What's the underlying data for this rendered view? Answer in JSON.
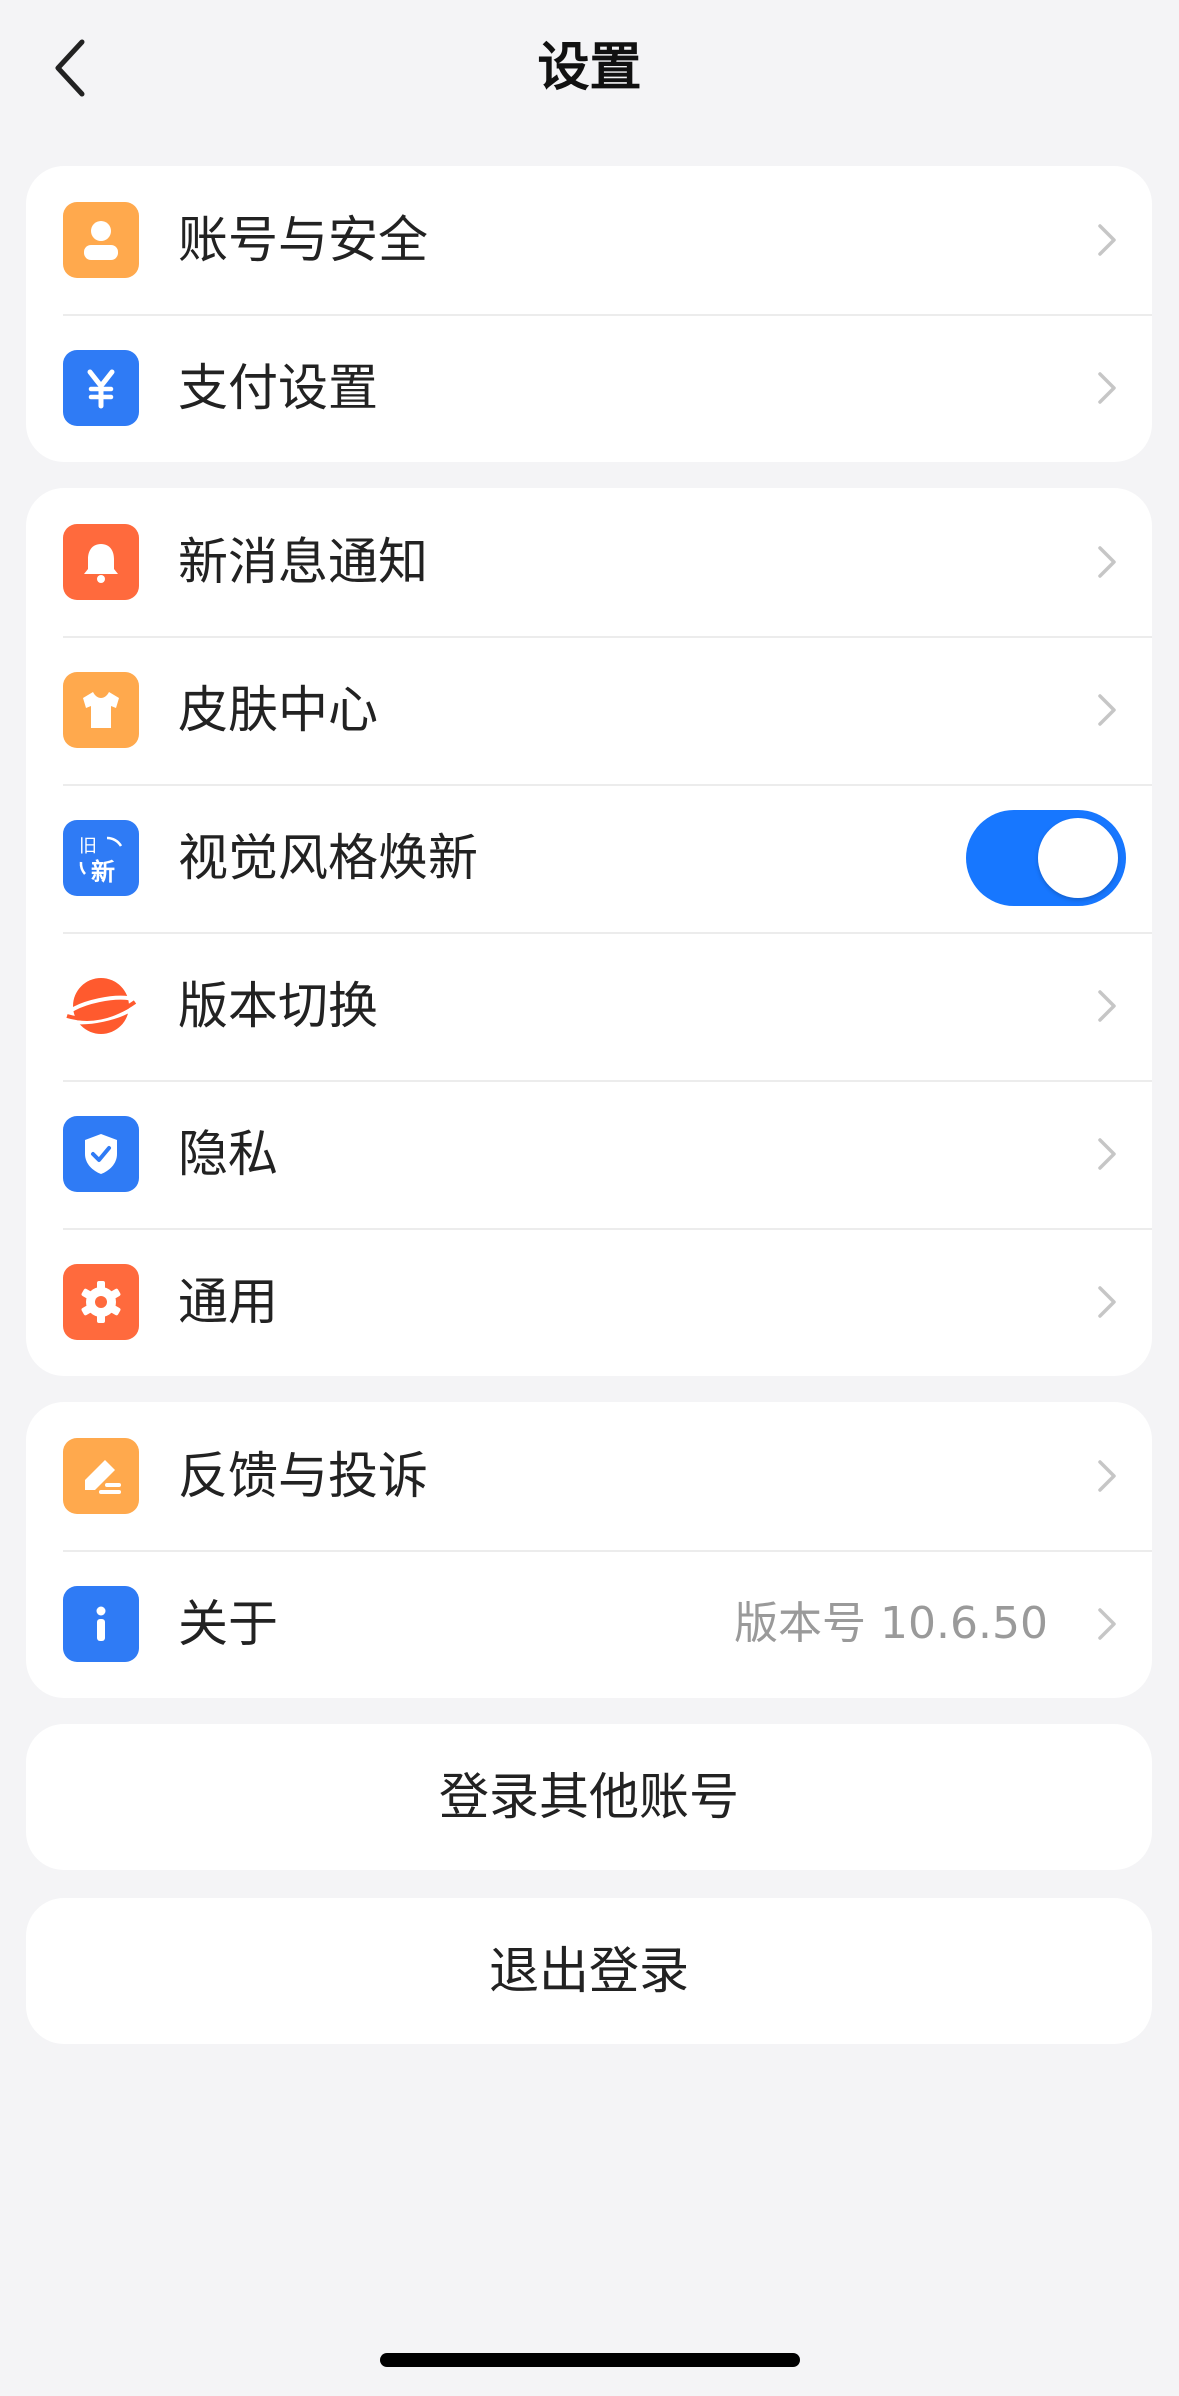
{
  "header": {
    "title": "设置",
    "back_icon": "chevron-left-icon"
  },
  "groups": [
    {
      "items": [
        {
          "label": "账号与安全",
          "icon": "user-icon",
          "color": "#ffa94d",
          "control": "chevron"
        },
        {
          "label": "支付设置",
          "icon": "yen-icon",
          "color": "#2f7bf5",
          "control": "chevron"
        }
      ]
    },
    {
      "items": [
        {
          "label": "新消息通知",
          "icon": "bell-icon",
          "color": "#ff6a3d",
          "control": "chevron"
        },
        {
          "label": "皮肤中心",
          "icon": "tshirt-icon",
          "color": "#ffa94d",
          "control": "chevron"
        },
        {
          "label": "视觉风格焕新",
          "icon": "refresh-new-icon",
          "icon_text_top": "旧",
          "icon_text_bottom": "新",
          "color": "#2f7bf5",
          "control": "toggle",
          "toggle_on": true
        },
        {
          "label": "版本切换",
          "icon": "planet-icon",
          "color": "#ff5a2e",
          "control": "chevron"
        },
        {
          "label": "隐私",
          "icon": "shield-check-icon",
          "color": "#2f7bf5",
          "control": "chevron"
        },
        {
          "label": "通用",
          "icon": "gear-icon",
          "color": "#ff6a3d",
          "control": "chevron"
        }
      ]
    },
    {
      "items": [
        {
          "label": "反馈与投诉",
          "icon": "edit-icon",
          "color": "#ffa94d",
          "control": "chevron"
        },
        {
          "label": "关于",
          "icon": "info-icon",
          "color": "#2f7bf5",
          "control": "chevron",
          "value": "版本号 10.6.50"
        }
      ]
    }
  ],
  "actions": {
    "switch_account": "登录其他账号",
    "logout": "退出登录"
  },
  "colors": {
    "toggle_on": "#1777ff",
    "background": "#f4f4f6"
  }
}
